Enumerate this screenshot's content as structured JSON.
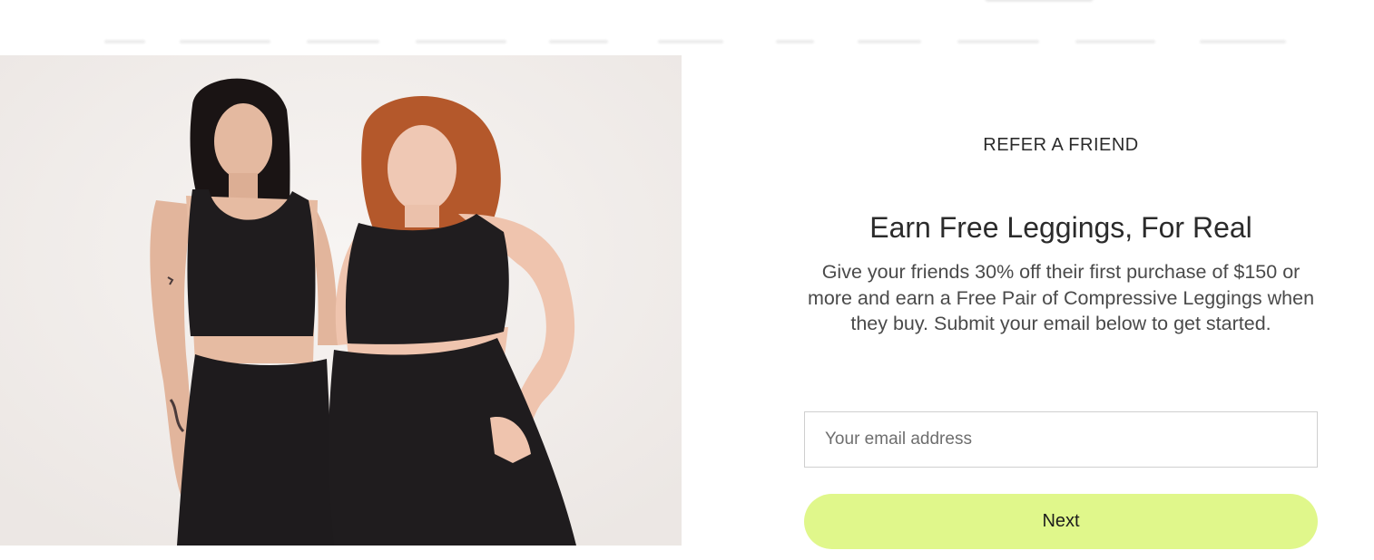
{
  "refer": {
    "eyebrow": "REFER A FRIEND",
    "headline": "Earn Free Leggings, For Real",
    "body": "Give your friends 30% off their first purchase of $150 or more and earn a Free Pair of Compressive Leggings when they buy. Submit your email below to get started."
  },
  "form": {
    "email_placeholder": "Your email address",
    "email_value": "",
    "submit_label": "Next"
  },
  "colors": {
    "accent": "#e0f78b",
    "text": "#2b2b2b",
    "border": "#cfcfcf"
  },
  "hero": {
    "icon": "model-photo"
  }
}
